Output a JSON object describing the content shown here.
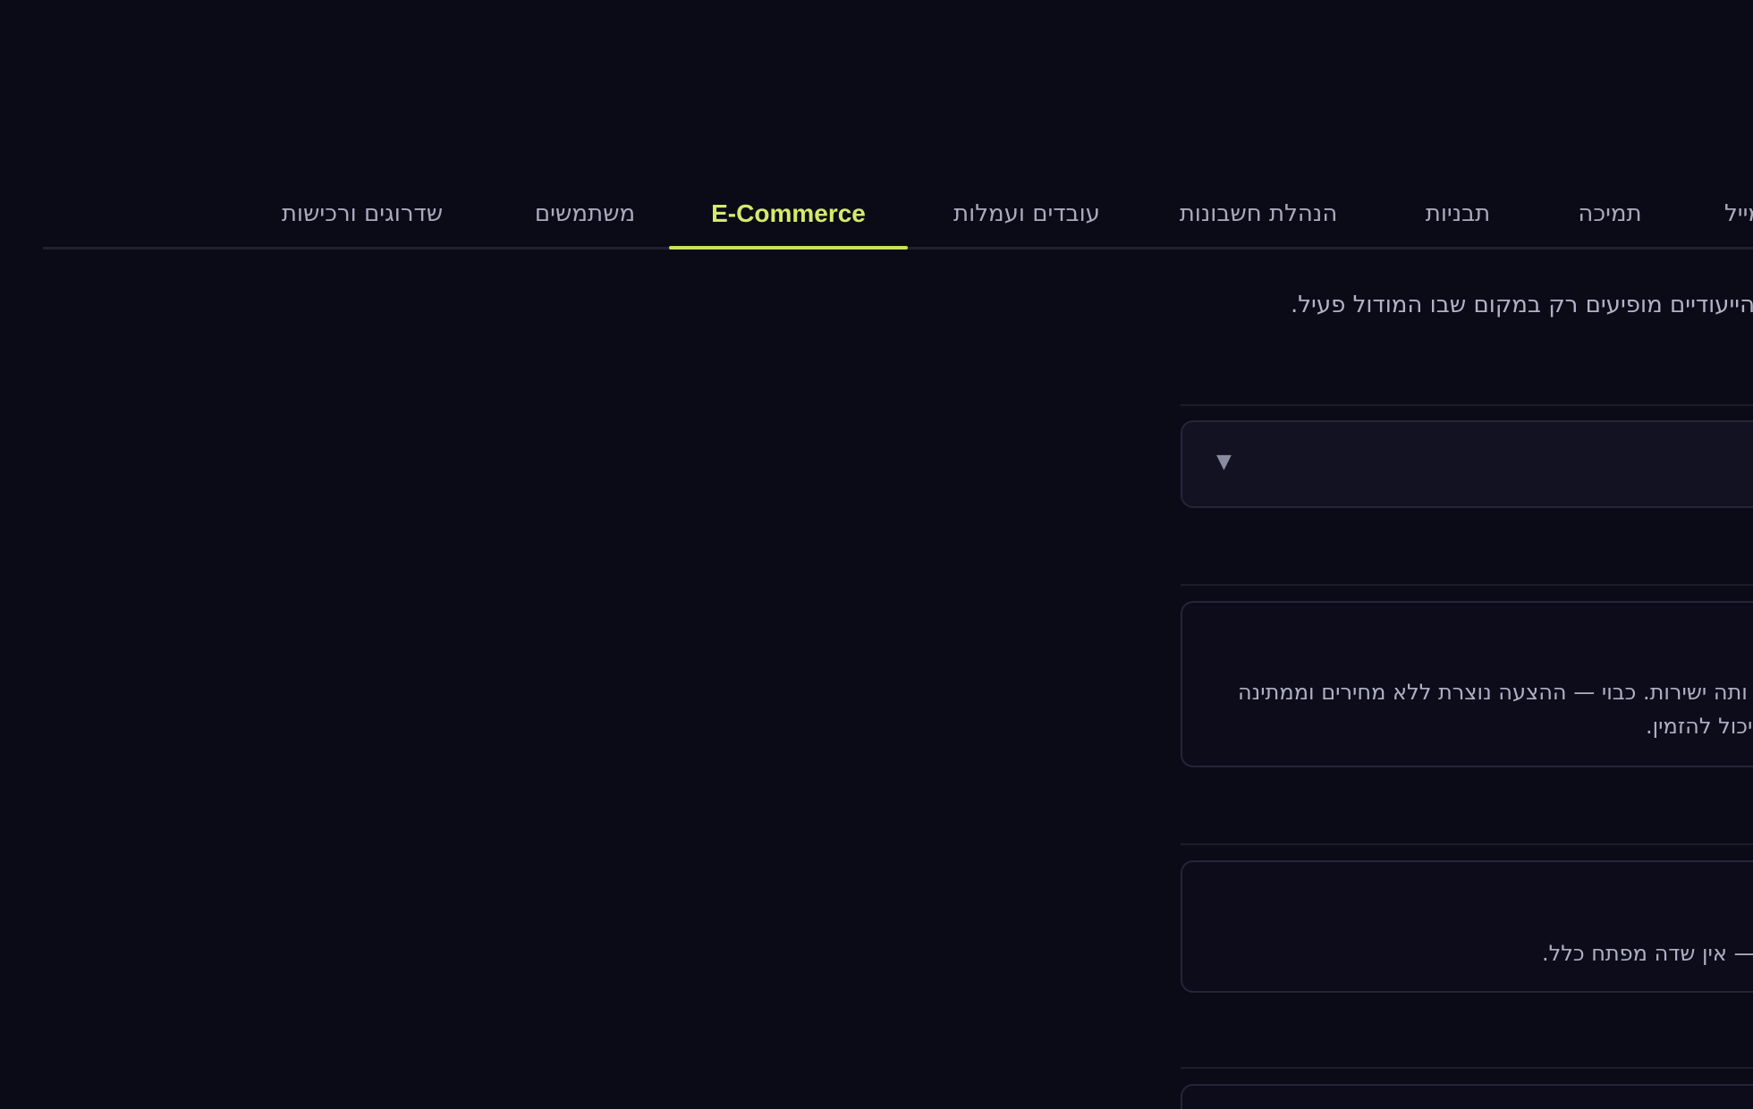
{
  "tabs": [
    {
      "label": "שדרוגים ורכישות"
    },
    {
      "label": "משתמשים"
    },
    {
      "label": "E-Commerce",
      "active": true
    },
    {
      "label": "עובדים ועמלות"
    },
    {
      "label": "הנהלת חשבונות"
    },
    {
      "label": "תבניות"
    },
    {
      "label": "תמיכה"
    },
    {
      "label": "מייל"
    }
  ],
  "description": "הייעודיים מופיעים רק במקום שבו המודול פעיל.",
  "select": {
    "caret_icon": "caret-down-icon"
  },
  "cards": [
    {
      "line1": "ותה ישירות. כבוי — ההצעה נוצרת ללא מחירים וממתינה",
      "line2": "יכול להזמין."
    },
    {
      "line1": "— אין שדה מפתח כלל."
    }
  ],
  "colors": {
    "background": "#0b0b18",
    "accent": "#d4ea6b",
    "tab_text": "#aaaabd",
    "border": "#25253a"
  }
}
